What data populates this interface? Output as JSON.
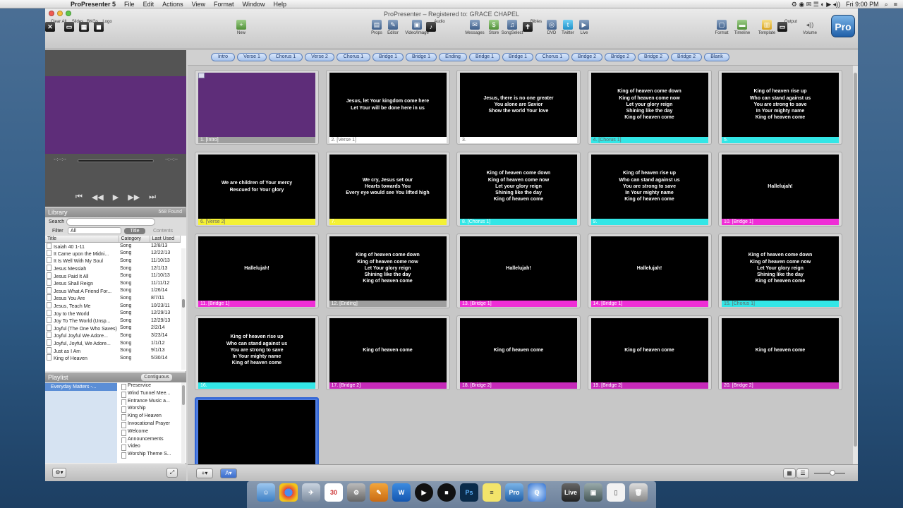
{
  "menubar": {
    "apple": "",
    "app_name": "ProPresenter 5",
    "menus": [
      "File",
      "Edit",
      "Actions",
      "View",
      "Format",
      "Window",
      "Help"
    ],
    "clock": "Fri 9:00 PM"
  },
  "window": {
    "title": "ProPresenter – Registered to: GRACE CHAPEL"
  },
  "toolbar": {
    "left": [
      {
        "label": "Clear All",
        "icon": "x-icon"
      },
      {
        "label": "Slides",
        "icon": "slides-icon"
      },
      {
        "label": "BKGs",
        "icon": "bkg-icon"
      },
      {
        "label": "Logo",
        "icon": "logo-icon"
      }
    ],
    "new_label": "New",
    "middle": [
      {
        "label": "Props",
        "icon": "props-icon"
      },
      {
        "label": "Editor",
        "icon": "editor-icon"
      },
      {
        "label": "Video/Image",
        "icon": "video-icon"
      },
      {
        "label": "Audio",
        "icon": "audio-icon"
      }
    ],
    "online": [
      {
        "label": "Messages",
        "icon": "messages-icon"
      },
      {
        "label": "Store",
        "icon": "store-icon"
      },
      {
        "label": "SongSelect",
        "icon": "songselect-icon"
      },
      {
        "label": "Bibles",
        "icon": "bible-icon"
      },
      {
        "label": "DVD",
        "icon": "dvd-icon"
      },
      {
        "label": "Twitter",
        "icon": "twitter-icon"
      },
      {
        "label": "Live",
        "icon": "live-icon"
      }
    ],
    "right": [
      {
        "label": "Format",
        "icon": "format-icon"
      },
      {
        "label": "Timeline",
        "icon": "timeline-icon"
      },
      {
        "label": "Template",
        "icon": "template-icon"
      },
      {
        "label": "Output",
        "icon": "output-icon"
      },
      {
        "label": "Volume",
        "icon": "volume-icon"
      }
    ],
    "logo": "Pro"
  },
  "preview": {
    "time_left": "--:--:--",
    "time_right": "--:--:--"
  },
  "library": {
    "title": "Library",
    "count": "568 Found",
    "search_label": "Search",
    "filter_label": "Filter",
    "filter_value": "All",
    "toggle_title": "Title",
    "toggle_contents": "Contents",
    "columns": [
      "Title",
      "Category",
      "Last Used"
    ],
    "rows": [
      [
        "Isaiah 40 1-11",
        "Song",
        "12/8/13"
      ],
      [
        "It Came upon the Midni...",
        "Song",
        "12/22/13"
      ],
      [
        "It Is Well With My Soul",
        "Song",
        "11/10/13"
      ],
      [
        "Jesus Messiah",
        "Song",
        "12/1/13"
      ],
      [
        "Jesus Paid It All",
        "Song",
        "11/10/13"
      ],
      [
        "Jesus Shall Reign",
        "Song",
        "11/11/12"
      ],
      [
        "Jesus What A Friend For...",
        "Song",
        "1/26/14"
      ],
      [
        "Jesus You Are",
        "Song",
        "8/7/11"
      ],
      [
        "Jesus, Teach Me",
        "Song",
        "10/23/11"
      ],
      [
        "Joy to the World",
        "Song",
        "12/29/13"
      ],
      [
        "Joy To The World (Unsp...",
        "Song",
        "12/29/13"
      ],
      [
        "Joyful (The One Who Saves)",
        "Song",
        "2/2/14"
      ],
      [
        "Joyful Joyful We Adore...",
        "Song",
        "3/23/14"
      ],
      [
        "Joyful, Joyful, We Adore...",
        "Song",
        "1/1/12"
      ],
      [
        "Just as I Am",
        "Song",
        "9/1/13"
      ],
      [
        "King of Heaven",
        "Song",
        "5/30/14"
      ]
    ]
  },
  "playlist": {
    "title": "Playlist",
    "mode": "Contiguous",
    "selected": "Everyday Matters -...",
    "items": [
      "Preservice",
      "Wind Tunnel Mee...",
      "Entrance Music a...",
      "Worship",
      "King of Heaven",
      "Invocational Prayer",
      "Welcome",
      "Announcements",
      "Video",
      "Worship Theme S..."
    ]
  },
  "groups": [
    {
      "label": "Intro",
      "w": 34
    },
    {
      "label": "Verse 1",
      "w": 42
    },
    {
      "label": "Chorus 1",
      "w": 48
    },
    {
      "label": "Verse 2",
      "w": 42
    },
    {
      "label": "Chorus 1",
      "w": 48
    },
    {
      "label": "Bridge 1",
      "w": 44
    },
    {
      "label": "Bridge 1",
      "w": 44
    },
    {
      "label": "Ending",
      "w": 40
    },
    {
      "label": "Bridge 1",
      "w": 44
    },
    {
      "label": "Bridge 1",
      "w": 44
    },
    {
      "label": "Chorus 1",
      "w": 48
    },
    {
      "label": "Bridge 2",
      "w": 44
    },
    {
      "label": "Bridge 2",
      "w": 44
    },
    {
      "label": "Bridge 2",
      "w": 44
    },
    {
      "label": "Bridge 2",
      "w": 44
    },
    {
      "label": "Blank",
      "w": 36
    }
  ],
  "colors": {
    "chorus": "#33e6e6",
    "verse2": "#f4f134",
    "bridge1": "#ef2ed6",
    "bridge2": "#c62ab9",
    "intro": "#5e2d79",
    "ending": "#9e9e9e",
    "none": "#ffffff",
    "current": "#2e63d6"
  },
  "slides": [
    {
      "label": "1. [Intro]",
      "text": "",
      "color": "#9e9e9e",
      "dark": false,
      "purple": true
    },
    {
      "label": "2. [Verse 1]",
      "text": "Jesus, let Your kingdom come here\nLet Your will be done here in us",
      "color": "#ffffff",
      "dark": true
    },
    {
      "label": "3.",
      "text": "Jesus, there is no one greater\nYou alone are Savior\nShow the world Your love",
      "color": "#ffffff",
      "dark": true
    },
    {
      "label": "4. [Chorus 1]",
      "text": "King of heaven come down\nKing of heaven come now\nLet your glory reign\nShining like the day\nKing of heaven come",
      "color": "#33e6e6",
      "dark": true
    },
    {
      "label": "5.",
      "text": "King of heaven rise up\nWho can stand against us\nYou are strong to save\nIn Your mighty name\nKing of heaven come",
      "color": "#33e6e6",
      "dark": false
    },
    {
      "label": "6. [Verse 2]",
      "text": "We are children of Your mercy\nRescued for Your glory",
      "color": "#f4f134",
      "dark": true
    },
    {
      "label": "7.",
      "text": "We cry, Jesus set our\nHearts towards You\nEvery eye would see You lifted high",
      "color": "#f4f134",
      "dark": false
    },
    {
      "label": "8. [Chorus 1]",
      "text": "King of heaven come down\nKing of heaven come now\nLet your glory reign\nShining like the day\nKing of heaven come",
      "color": "#33e6e6",
      "dark": false
    },
    {
      "label": "9.",
      "text": "King of heaven rise up\nWho can stand against us\nYou are strong to save\nIn Your mighty name\nKing of heaven come",
      "color": "#33e6e6",
      "dark": false
    },
    {
      "label": "10. [Bridge 1]",
      "text": "Hallelujah!",
      "color": "#ef2ed6",
      "dark": false
    },
    {
      "label": "11. [Bridge 1]",
      "text": "Hallelujah!",
      "color": "#ef2ed6",
      "dark": false
    },
    {
      "label": "12. [Ending]",
      "text": "King of heaven come down\nKing of heaven come now\nLet Your glory reign\nShining like the day\nKing of heaven come",
      "color": "#9e9e9e",
      "dark": false
    },
    {
      "label": "13. [Bridge 1]",
      "text": "Hallelujah!",
      "color": "#ef2ed6",
      "dark": false
    },
    {
      "label": "14. [Bridge 1]",
      "text": "Hallelujah!",
      "color": "#ef2ed6",
      "dark": false
    },
    {
      "label": "15. [Chorus 1]",
      "text": "King of heaven come down\nKing of heaven come now\nLet Your glory reign\nShining like the day\nKing of heaven come",
      "color": "#33e6e6",
      "dark": true
    },
    {
      "label": "16.",
      "text": "King of heaven rise up\nWho can stand against us\nYou are strong to save\nIn Your mighty name\nKing of heaven come",
      "color": "#33e6e6",
      "dark": false
    },
    {
      "label": "17. [Bridge 2]",
      "text": "King of heaven come",
      "color": "#c62ab9",
      "dark": false
    },
    {
      "label": "18. [Bridge 2]",
      "text": "King of heaven come",
      "color": "#c62ab9",
      "dark": false
    },
    {
      "label": "19. [Bridge 2]",
      "text": "King of heaven come",
      "color": "#c62ab9",
      "dark": false
    },
    {
      "label": "20. [Bridge 2]",
      "text": "King of heaven come",
      "color": "#c62ab9",
      "dark": false
    },
    {
      "label": "",
      "text": "",
      "color": "#2e63d6",
      "dark": false,
      "current": true
    }
  ]
}
